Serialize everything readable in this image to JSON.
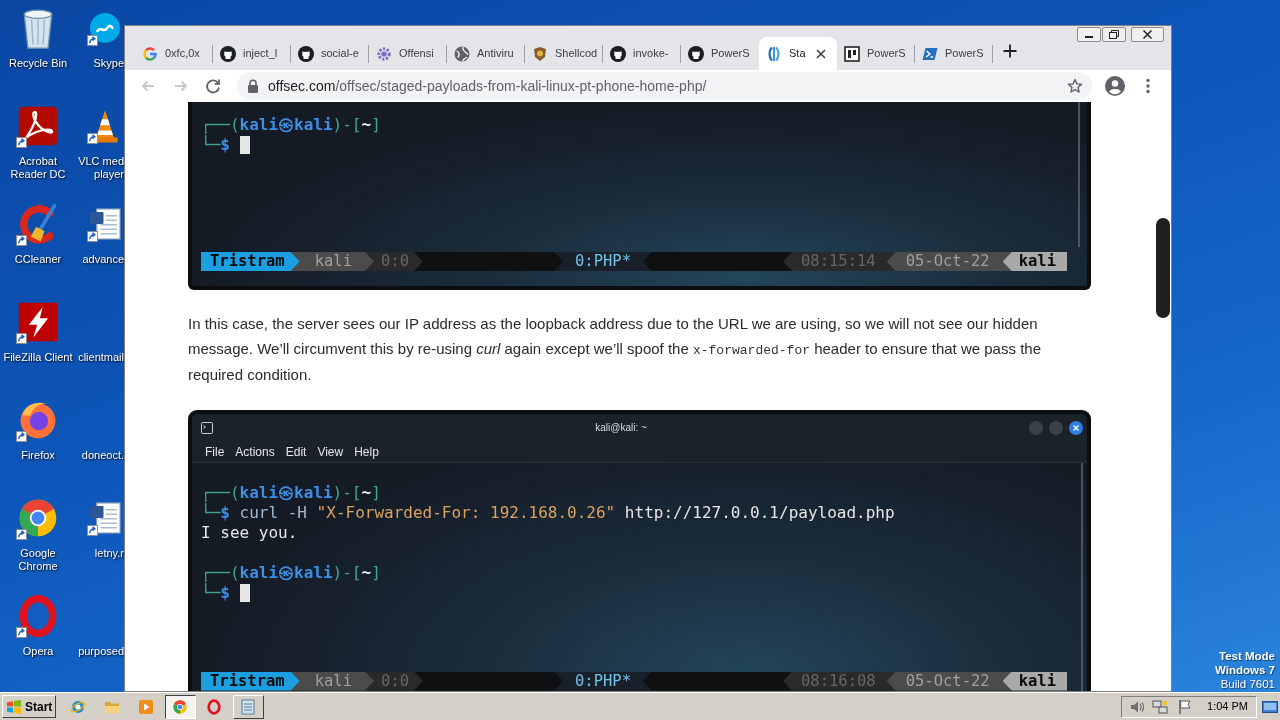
{
  "desktop": {
    "icon_columns": [
      [
        {
          "kind": "recycle_bin",
          "label": [
            "Recycle Bin"
          ],
          "shortcut": false
        },
        {
          "kind": "acrobat",
          "label": [
            "Acrobat",
            "Reader DC"
          ],
          "shortcut": true
        },
        {
          "kind": "ccleaner",
          "label": [
            "CCleaner"
          ],
          "shortcut": true
        },
        {
          "kind": "filezilla",
          "label": [
            "FileZilla Client"
          ],
          "shortcut": true
        },
        {
          "kind": "firefox",
          "label": [
            "Firefox"
          ],
          "shortcut": true
        },
        {
          "kind": "chrome",
          "label": [
            "Google",
            "Chrome"
          ],
          "shortcut": true
        },
        {
          "kind": "opera",
          "label": [
            "Opera"
          ],
          "shortcut": true
        }
      ],
      [
        {
          "kind": "skype",
          "label": [
            "Skype"
          ],
          "shortcut": true
        },
        {
          "kind": "vlc",
          "label": [
            "VLC med",
            "player"
          ],
          "shortcut": true
        },
        {
          "kind": "word",
          "label": [
            "advance"
          ],
          "shortcut": true
        },
        {
          "kind": "none",
          "label": [
            "clientmail"
          ],
          "shortcut": false
        },
        {
          "kind": "none",
          "label": [
            "doneoct."
          ],
          "shortcut": false
        },
        {
          "kind": "word",
          "label": [
            "letny.r"
          ],
          "shortcut": true
        },
        {
          "kind": "none",
          "label": [
            "purposed"
          ],
          "shortcut": false
        }
      ]
    ],
    "system_notice": [
      {
        "text": "Test Mode",
        "bold": true
      },
      {
        "text": "Windows 7",
        "bold": true
      },
      {
        "text": "Build 7601",
        "bold": false
      }
    ]
  },
  "browser": {
    "tabs": [
      {
        "kind": "google",
        "title": "0xfc,0x",
        "selected": false
      },
      {
        "kind": "github",
        "title": "inject_l",
        "selected": false
      },
      {
        "kind": "github",
        "title": "social-e",
        "selected": false
      },
      {
        "kind": "gear",
        "title": "Offensi",
        "selected": false
      },
      {
        "kind": "globe",
        "title": "Antiviru",
        "selected": false
      },
      {
        "kind": "crest",
        "title": "Shellcod",
        "selected": false
      },
      {
        "kind": "github",
        "title": "invoke-",
        "selected": false
      },
      {
        "kind": "github",
        "title": "PowerS",
        "selected": false
      },
      {
        "kind": "offsec",
        "title": "Sta",
        "selected": true
      },
      {
        "kind": "pt",
        "title": "PowerS",
        "selected": false
      },
      {
        "kind": "powershell",
        "title": "PowerS",
        "selected": false
      }
    ],
    "nav": {
      "back": {
        "disabled": true
      },
      "forward": {
        "disabled": true
      }
    },
    "address": {
      "host": "offsec.com",
      "path": "/offsec/staged-payloads-from-kali-linux-pt-phone-home-php/"
    },
    "page": {
      "blocks": [
        {
          "kind": "terminal",
          "lines": [
            {
              "kind": "text",
              "segments": [
                {
                  "kind": "frame",
                  "text": "┌──("
                },
                {
                  "kind": "user",
                  "text": "kali㉿kali"
                },
                {
                  "kind": "frame",
                  "text": ")-["
                },
                {
                  "kind": "path",
                  "text": "~"
                },
                {
                  "kind": "frame",
                  "text": "]"
                }
              ],
              "cursor": false
            },
            {
              "kind": "text",
              "segments": [
                {
                  "kind": "frame",
                  "text": "└─"
                },
                {
                  "kind": "prompt",
                  "text": "$"
                }
              ],
              "cursor": true
            }
          ],
          "status_bar": {
            "left": [
              {
                "kind": "session",
                "text": "Tristram"
              },
              {
                "kind": "host",
                "text": "kali"
              },
              {
                "kind": "pane",
                "text": "0:0"
              }
            ],
            "window": "0:PHP*",
            "right": [
              {
                "kind": "time",
                "text": "08:15:14"
              },
              {
                "kind": "date",
                "text": "05-Oct-22"
              },
              {
                "kind": "user",
                "text": "kali"
              }
            ]
          }
        },
        {
          "kind": "paragraph",
          "segments": [
            {
              "kind": "text",
              "text": "In this case, the server sees our IP address as the loopback address due to the URL we are using, so we will not see our hidden message. We’ll circumvent this by re-using *curl* again except we’ll spoof the "
            },
            {
              "kind": "code",
              "text": "x-forwarded-for"
            },
            {
              "kind": "text",
              "text": " header to ensure that we pass the required condition."
            }
          ]
        },
        {
          "kind": "terminal",
          "title": "kali@kali: ~",
          "menu": [
            "File",
            "Actions",
            "Edit",
            "View",
            "Help"
          ],
          "lines": [
            {
              "kind": "text",
              "segments": [
                {
                  "kind": "frame",
                  "text": "┌──("
                },
                {
                  "kind": "user",
                  "text": "kali㉿kali"
                },
                {
                  "kind": "frame",
                  "text": ")-["
                },
                {
                  "kind": "path",
                  "text": "~"
                },
                {
                  "kind": "frame",
                  "text": "]"
                }
              ],
              "cursor": false
            },
            {
              "kind": "text",
              "segments": [
                {
                  "kind": "frame",
                  "text": "└─"
                },
                {
                  "kind": "prompt",
                  "text": "$"
                },
                {
                  "kind": "command",
                  "text": " curl -H "
                },
                {
                  "kind": "string",
                  "text": "\"X-Forwarded-For: 192.168.0.26\""
                },
                {
                  "kind": "plain",
                  "text": " http://127.0.0.1/payload.php"
                }
              ],
              "cursor": false
            },
            {
              "kind": "text",
              "segments": [
                {
                  "kind": "plain",
                  "text": "I see you."
                }
              ],
              "cursor": false
            },
            {
              "kind": "blank"
            },
            {
              "kind": "text",
              "segments": [
                {
                  "kind": "frame",
                  "text": "┌──("
                },
                {
                  "kind": "user",
                  "text": "kali㉿kali"
                },
                {
                  "kind": "frame",
                  "text": ")-["
                },
                {
                  "kind": "path",
                  "text": "~"
                },
                {
                  "kind": "frame",
                  "text": "]"
                }
              ],
              "cursor": false
            },
            {
              "kind": "text",
              "segments": [
                {
                  "kind": "frame",
                  "text": "└─"
                },
                {
                  "kind": "prompt",
                  "text": "$"
                }
              ],
              "cursor": true
            }
          ],
          "status_bar": {
            "left": [
              {
                "kind": "session",
                "text": "Tristram"
              },
              {
                "kind": "host",
                "text": "kali"
              },
              {
                "kind": "pane",
                "text": "0:0"
              }
            ],
            "window": "0:PHP*",
            "right": [
              {
                "kind": "time",
                "text": "08:16:08"
              },
              {
                "kind": "date",
                "text": "05-Oct-22"
              },
              {
                "kind": "user",
                "text": "kali"
              }
            ]
          }
        }
      ]
    }
  },
  "taskbar": {
    "start": "Start",
    "items": [
      {
        "kind": "ie",
        "framed": false,
        "selected": false
      },
      {
        "kind": "explorer",
        "framed": false,
        "selected": false
      },
      {
        "kind": "media_player",
        "framed": false,
        "selected": false
      },
      {
        "kind": "chrome",
        "framed": true,
        "selected": true
      },
      {
        "kind": "opera",
        "framed": false,
        "selected": false
      },
      {
        "kind": "notepad",
        "framed": true,
        "selected": false
      }
    ],
    "tray": [
      {
        "kind": "speaker"
      },
      {
        "kind": "network"
      },
      {
        "kind": "flag"
      }
    ],
    "clock": "1:04 PM"
  }
}
